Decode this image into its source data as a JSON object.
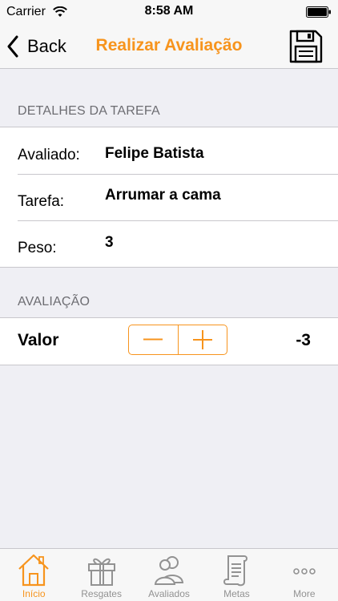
{
  "status_bar": {
    "carrier": "Carrier",
    "time": "8:58 AM"
  },
  "nav": {
    "back_label": "Back",
    "title": "Realizar Avaliação",
    "save_icon": "floppy-disk-icon"
  },
  "details": {
    "header": "DETALHES DA TAREFA",
    "rows": [
      {
        "label": "Avaliado:",
        "value": "Felipe Batista"
      },
      {
        "label": "Tarefa:",
        "value": "Arrumar a cama"
      },
      {
        "label": "Peso:",
        "value": "3"
      }
    ]
  },
  "evaluation": {
    "header": "AVALIAÇÃO",
    "label": "Valor",
    "value": "-3",
    "decrement_icon": "minus-icon",
    "increment_icon": "plus-icon"
  },
  "tabs": [
    {
      "label": "Início",
      "icon": "home-icon",
      "active": true
    },
    {
      "label": "Resgates",
      "icon": "gift-icon",
      "active": false
    },
    {
      "label": "Avaliados",
      "icon": "people-icon",
      "active": false
    },
    {
      "label": "Metas",
      "icon": "scroll-icon",
      "active": false
    },
    {
      "label": "More",
      "icon": "more-icon",
      "active": false
    }
  ],
  "colors": {
    "accent": "#f7941d",
    "background": "#efeff4",
    "inactive_tab": "#929292"
  }
}
